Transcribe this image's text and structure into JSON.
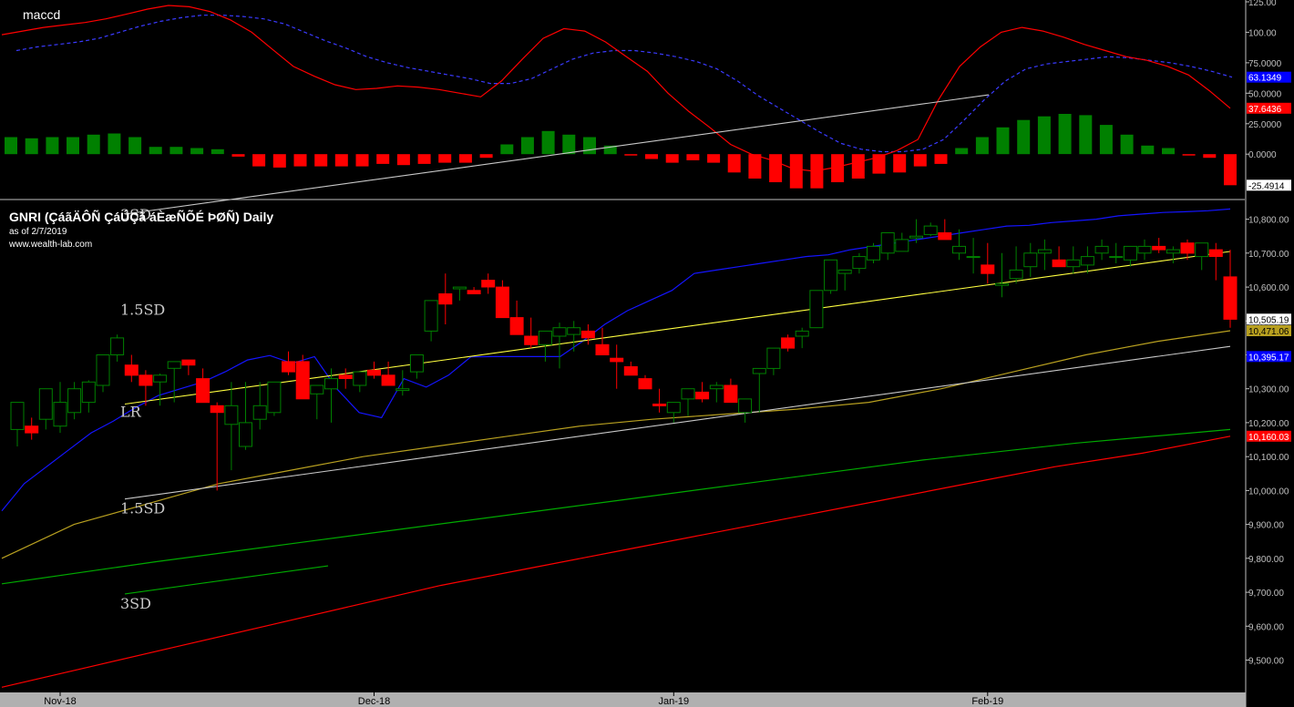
{
  "chart_data": [
    {
      "type": "bar",
      "panel": "macd",
      "title": "maccd",
      "ylim": [
        -35,
        125
      ],
      "yticks": [
        "125.00",
        "100.00",
        "75.0000",
        "50.0000",
        "25.0000",
        "0.0000"
      ],
      "last_values": {
        "signal": "63.1349",
        "macd": "37.6436",
        "histogram": "-25.4914"
      },
      "colors": {
        "macd": "#ff0000",
        "signal": "#3a3aff",
        "hist_up": "#008000",
        "hist_down": "#ff0000"
      },
      "series": [
        {
          "name": "macd",
          "values": [
            98,
            101,
            104,
            106,
            108,
            111,
            115,
            119,
            122,
            121,
            117,
            110,
            100,
            86,
            72,
            64,
            57,
            53,
            54,
            56,
            55,
            53,
            50,
            47,
            60,
            78,
            95,
            103,
            101,
            92,
            80,
            68,
            50,
            35,
            22,
            8,
            0,
            -5,
            -12,
            -14,
            -11,
            -7,
            -3,
            3,
            12,
            45,
            72,
            88,
            100,
            104,
            101,
            96,
            90,
            85,
            80,
            77,
            72,
            65,
            52,
            37.6436
          ]
        },
        {
          "name": "signal",
          "values": [
            85,
            88,
            90,
            92,
            95,
            100,
            105,
            109,
            112,
            114,
            114,
            113,
            111,
            107,
            100,
            93,
            87,
            80,
            75,
            71,
            68,
            65,
            62,
            58,
            58,
            62,
            70,
            78,
            83,
            85,
            85,
            83,
            80,
            76,
            70,
            60,
            48,
            38,
            28,
            18,
            9,
            4,
            2,
            2,
            4,
            12,
            28,
            45,
            60,
            70,
            74,
            76,
            78,
            80,
            79,
            77,
            75,
            72,
            68,
            63.1349
          ]
        },
        {
          "name": "histogram",
          "values": [
            14,
            13,
            14,
            14,
            16,
            17,
            14,
            6,
            6,
            5,
            4,
            -2,
            -10,
            -11,
            -10,
            -10,
            -10,
            -10,
            -8,
            -9,
            -8,
            -7,
            -7,
            -3,
            8,
            14,
            19,
            16,
            14,
            7,
            -1,
            -4,
            -7,
            -5,
            -7,
            -15,
            -20,
            -23,
            -28,
            -28,
            -23,
            -20,
            -16,
            -15,
            -10,
            -8,
            5,
            14,
            22,
            28,
            31,
            33,
            32,
            24,
            16,
            7,
            5,
            -1,
            -3,
            -25.4914
          ]
        }
      ]
    },
    {
      "type": "candlestick",
      "panel": "price",
      "title": "GNRI (ÇáãÄÔÑ ÇáÚÇã áÈæÑÕÉ ÞØÑ) Daily",
      "subtitle": "as of 2/7/2019",
      "source": "www.wealth-lab.com",
      "ylim": [
        9410,
        10850
      ],
      "yticks": [
        "10,800.00",
        "10,700.00",
        "10,600.00",
        "10,500.00",
        "10,400.00",
        "10,300.00",
        "10,200.00",
        "10,100.00",
        "10,000.00",
        "9,900.00",
        "9,800.00",
        "9,700.00",
        "9,600.00",
        "9,500.00"
      ],
      "x_labels": [
        {
          "label": "Nov-18",
          "bar": 3
        },
        {
          "label": "Dec-18",
          "bar": 25
        },
        {
          "label": "Jan-19",
          "bar": 46
        },
        {
          "label": "Feb-19",
          "bar": 68
        }
      ],
      "band_labels": {
        "upper3": "3SD",
        "upper15": "1.5SD",
        "mid": "LR",
        "lower15": "1.5SD",
        "lower3": "3SD"
      },
      "last_values": {
        "ma_blue": "10,395.17",
        "close": "10,505.19",
        "ma_olive": "10,471.06",
        "ma_red": "10,160.03"
      },
      "colors": {
        "up": "#008000",
        "down": "#ff0000",
        "ma_blue": "#1414ff",
        "ma_olive": "#b8a020",
        "ma_green": "#00aa00",
        "ma_red": "#ff0000",
        "regression": "#ffff40",
        "band": "#c8c8c8"
      },
      "candles": {
        "open": [
          10180,
          10190,
          10210,
          10190,
          10230,
          10260,
          10310,
          10400,
          10370,
          10340,
          10320,
          10360,
          10385,
          10330,
          10250,
          10195,
          10130,
          10210,
          10230,
          10380,
          10380,
          10285,
          10300,
          10340,
          10310,
          10355,
          10340,
          10295,
          10350,
          10470,
          10580,
          10595,
          10590,
          10620,
          10600,
          10510,
          10455,
          10430,
          10455,
          10460,
          10470,
          10430,
          10390,
          10365,
          10330,
          10255,
          10230,
          10270,
          10290,
          10300,
          10310,
          10230,
          10345,
          10360,
          10450,
          10455,
          10480,
          10590,
          10640,
          10655,
          10680,
          10700,
          10705,
          10745,
          10755,
          10760,
          10700,
          10690,
          10665,
          10605,
          10625,
          10660,
          10700,
          10680,
          10660,
          10665,
          10700,
          10690,
          10680,
          10700,
          10720,
          10700,
          10730,
          10690,
          10710,
          10630
        ],
        "high": [
          10210,
          10215,
          10225,
          10320,
          10320,
          10325,
          10400,
          10460,
          10400,
          10355,
          10345,
          10360,
          10380,
          10360,
          10260,
          10320,
          10320,
          10320,
          10320,
          10410,
          10400,
          10310,
          10360,
          10360,
          10320,
          10380,
          10380,
          10355,
          10380,
          10500,
          10640,
          10600,
          10600,
          10640,
          10620,
          10560,
          10510,
          10470,
          10495,
          10500,
          10490,
          10480,
          10430,
          10380,
          10340,
          10300,
          10260,
          10300,
          10320,
          10320,
          10330,
          10250,
          10350,
          10370,
          10460,
          10480,
          10550,
          10650,
          10650,
          10700,
          10730,
          10740,
          10760,
          10800,
          10790,
          10800,
          10770,
          10745,
          10730,
          10700,
          10720,
          10730,
          10740,
          10720,
          10720,
          10720,
          10740,
          10730,
          10710,
          10740,
          10745,
          10720,
          10740,
          10730,
          10730,
          10710
        ],
        "low": [
          10130,
          10150,
          10180,
          10170,
          10210,
          10230,
          10290,
          10380,
          10320,
          10250,
          10250,
          10260,
          10340,
          10260,
          10000,
          10060,
          10120,
          10180,
          10220,
          10340,
          10300,
          10210,
          10200,
          10300,
          10290,
          10330,
          10330,
          10280,
          10330,
          10440,
          10490,
          10560,
          10580,
          10580,
          10540,
          10460,
          10420,
          10380,
          10360,
          10410,
          10430,
          10400,
          10300,
          10340,
          10310,
          10230,
          10200,
          10220,
          10260,
          10260,
          10290,
          10200,
          10230,
          10340,
          10410,
          10420,
          10480,
          10580,
          10590,
          10640,
          10670,
          10680,
          10710,
          10730,
          10750,
          10760,
          10680,
          10640,
          10610,
          10570,
          10610,
          10630,
          10650,
          10660,
          10640,
          10640,
          10680,
          10670,
          10660,
          10680,
          10700,
          10670,
          10680,
          10650,
          10620,
          10480
        ],
        "close": [
          10260,
          10170,
          10300,
          10260,
          10300,
          10320,
          10400,
          10450,
          10340,
          10310,
          10340,
          10380,
          10370,
          10260,
          10230,
          10250,
          10200,
          10250,
          10320,
          10350,
          10270,
          10310,
          10330,
          10330,
          10350,
          10340,
          10310,
          10300,
          10400,
          10560,
          10550,
          10600,
          10580,
          10600,
          10510,
          10460,
          10430,
          10470,
          10480,
          10480,
          10450,
          10400,
          10380,
          10340,
          10300,
          10250,
          10260,
          10300,
          10270,
          10310,
          10260,
          10270,
          10360,
          10420,
          10420,
          10470,
          10590,
          10680,
          10650,
          10690,
          10720,
          10760,
          10740,
          10750,
          10780,
          10740,
          10720,
          10690,
          10640,
          10610,
          10650,
          10700,
          10710,
          10660,
          10680,
          10690,
          10720,
          10690,
          10720,
          10720,
          10710,
          10710,
          10700,
          10730,
          10690,
          10505.19
        ]
      },
      "series": [
        {
          "name": "ma_blue",
          "values": [
            9940,
            10020,
            10070,
            10120,
            10170,
            10205,
            10245,
            10280,
            10300,
            10320,
            10350,
            10385,
            10398,
            10375,
            10395,
            10300,
            10230,
            10215,
            10330,
            10305,
            10340,
            10394,
            10395,
            10395,
            10395,
            10395,
            10440,
            10490,
            10530,
            10560,
            10590,
            10640,
            10650,
            10660,
            10670,
            10680,
            10690,
            10695,
            10710,
            10720,
            10730,
            10740,
            10750,
            10760,
            10770,
            10780,
            10782,
            10790,
            10795,
            10800,
            10810,
            10815,
            10820,
            10822,
            10825,
            10830
          ]
        },
        {
          "name": "ma_olive",
          "values": [
            9800,
            9900,
            9960,
            10020,
            10060,
            10100,
            10130,
            10160,
            10190,
            10210,
            10225,
            10240,
            10260,
            10300,
            10350,
            10400,
            10440,
            10471.06
          ]
        },
        {
          "name": "ma_green",
          "values": [
            9725,
            9790,
            9850,
            9910,
            9970,
            10030,
            10090,
            10140,
            10180
          ]
        },
        {
          "name": "ma_red",
          "values": [
            9420,
            9480,
            9540,
            9600,
            9660,
            9720,
            9770,
            9820,
            9870,
            9920,
            9970,
            10020,
            10070,
            10110,
            10160.03
          ]
        }
      ],
      "regression": {
        "start": 10255,
        "end": 10705
      },
      "band_offset_15sd": 280,
      "band_offset_3sd": 560
    }
  ]
}
